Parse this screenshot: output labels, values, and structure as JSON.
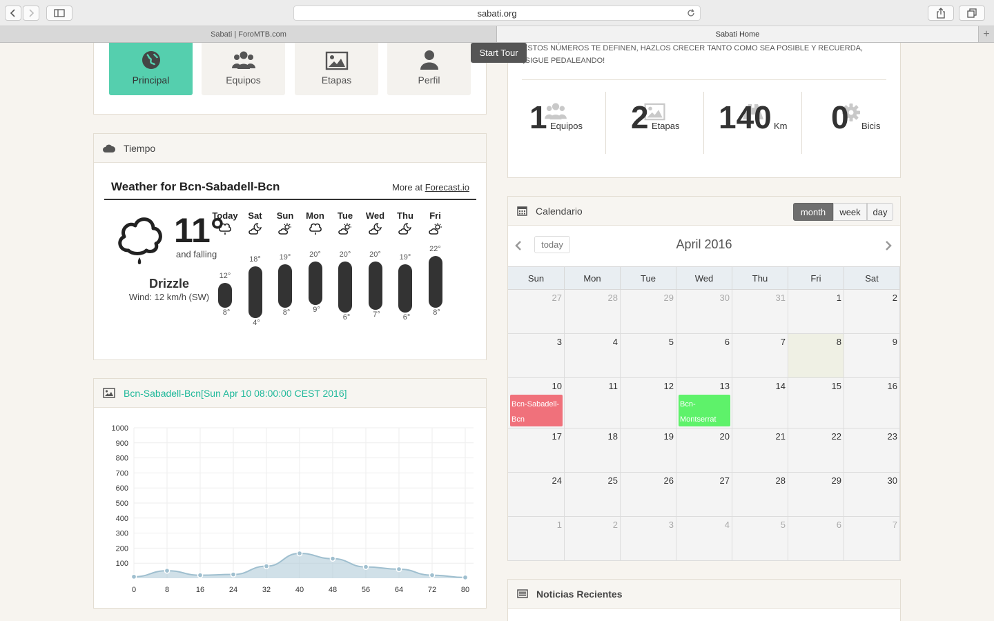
{
  "browser": {
    "url": "sabati.org",
    "tabs": [
      {
        "label": "Sabati | ForoMTB.com",
        "active": false
      },
      {
        "label": "Sabati Home",
        "active": true
      }
    ],
    "new_tab": "+"
  },
  "nav_tiles": [
    {
      "label": "Principal",
      "icon": "globe-icon",
      "active": true
    },
    {
      "label": "Equipos",
      "icon": "group-icon",
      "active": false
    },
    {
      "label": "Etapas",
      "icon": "image-icon",
      "active": false
    },
    {
      "label": "Perfil",
      "icon": "user-icon",
      "active": false
    }
  ],
  "start_tour": "Start Tour",
  "stats_box": {
    "message": "ESTOS NÚMEROS TE DEFINEN, HAZLOS CRECER TANTO COMO SEA POSIBLE Y RECUERDA, ¡SIGUE PEDALEANDO!",
    "stats": [
      {
        "value": "1",
        "label": "Equipos",
        "icon": "group-icon"
      },
      {
        "value": "2",
        "label": "Etapas",
        "icon": "image-icon"
      },
      {
        "value": "140",
        "label": "Km",
        "icon": "road-icon"
      },
      {
        "value": "0",
        "label": "Bicis",
        "icon": "gear-icon"
      }
    ]
  },
  "weather_box": {
    "header": "Tiempo",
    "title": "Weather for Bcn-Sabadell-Bcn",
    "more_prefix": "More at",
    "more_link": "Forecast.io",
    "current_temp": "11°",
    "trend": "and falling",
    "summary": "Drizzle",
    "wind": "Wind: 12 km/h (SW)",
    "forecast": [
      {
        "day": "Today",
        "high": "12°",
        "low": "8°",
        "high_val": 12,
        "low_val": 8,
        "icon": "drizzle-icon"
      },
      {
        "day": "Sat",
        "high": "18°",
        "low": "4°",
        "high_val": 18,
        "low_val": 4,
        "icon": "partly-cloudy-night-icon"
      },
      {
        "day": "Sun",
        "high": "19°",
        "low": "8°",
        "high_val": 19,
        "low_val": 8,
        "icon": "partly-cloudy-day-icon"
      },
      {
        "day": "Mon",
        "high": "20°",
        "low": "9°",
        "high_val": 20,
        "low_val": 9,
        "icon": "drizzle-icon"
      },
      {
        "day": "Tue",
        "high": "20°",
        "low": "6°",
        "high_val": 20,
        "low_val": 6,
        "icon": "partly-cloudy-day-icon"
      },
      {
        "day": "Wed",
        "high": "20°",
        "low": "7°",
        "high_val": 20,
        "low_val": 7,
        "icon": "partly-cloudy-night-icon"
      },
      {
        "day": "Thu",
        "high": "19°",
        "low": "6°",
        "high_val": 19,
        "low_val": 6,
        "icon": "partly-cloudy-night-icon"
      },
      {
        "day": "Fri",
        "high": "22°",
        "low": "8°",
        "high_val": 22,
        "low_val": 8,
        "icon": "partly-cloudy-day-icon"
      }
    ]
  },
  "profile_box": {
    "header": "Bcn-Sabadell-Bcn[Sun Apr 10 08:00:00 CEST 2016]"
  },
  "chart_data": {
    "type": "area",
    "title": "",
    "xlabel": "",
    "ylabel": "",
    "x": [
      0,
      8,
      16,
      24,
      32,
      40,
      48,
      56,
      64,
      72,
      80
    ],
    "series": [
      {
        "values": [
          10,
          50,
          20,
          25,
          80,
          165,
          130,
          75,
          60,
          20,
          5
        ]
      }
    ],
    "xticks": [
      "0",
      "8",
      "16",
      "24",
      "32",
      "40",
      "48",
      "56",
      "64",
      "72",
      "80"
    ],
    "yticks": [
      "100",
      "200",
      "300",
      "400",
      "500",
      "600",
      "700",
      "800",
      "900",
      "1000"
    ],
    "xlim": [
      0,
      80
    ],
    "ylim": [
      0,
      1000
    ],
    "grid": true,
    "color": "#a9c7d6"
  },
  "calendar": {
    "header": "Calendario",
    "views": [
      {
        "label": "month",
        "active": true
      },
      {
        "label": "week",
        "active": false
      },
      {
        "label": "day",
        "active": false
      }
    ],
    "today_label": "today",
    "month_title": "April 2016",
    "weekdays": [
      "Sun",
      "Mon",
      "Tue",
      "Wed",
      "Thu",
      "Fri",
      "Sat"
    ],
    "weeks": [
      [
        {
          "d": "27",
          "o": true
        },
        {
          "d": "28",
          "o": true
        },
        {
          "d": "29",
          "o": true
        },
        {
          "d": "30",
          "o": true
        },
        {
          "d": "31",
          "o": true
        },
        {
          "d": "1"
        },
        {
          "d": "2"
        }
      ],
      [
        {
          "d": "3"
        },
        {
          "d": "4"
        },
        {
          "d": "5"
        },
        {
          "d": "6"
        },
        {
          "d": "7"
        },
        {
          "d": "8",
          "t": true
        },
        {
          "d": "9"
        }
      ],
      [
        {
          "d": "10"
        },
        {
          "d": "11"
        },
        {
          "d": "12"
        },
        {
          "d": "13"
        },
        {
          "d": "14"
        },
        {
          "d": "15"
        },
        {
          "d": "16"
        }
      ],
      [
        {
          "d": "17"
        },
        {
          "d": "18"
        },
        {
          "d": "19"
        },
        {
          "d": "20"
        },
        {
          "d": "21"
        },
        {
          "d": "22"
        },
        {
          "d": "23"
        }
      ],
      [
        {
          "d": "24"
        },
        {
          "d": "25"
        },
        {
          "d": "26"
        },
        {
          "d": "27"
        },
        {
          "d": "28"
        },
        {
          "d": "29"
        },
        {
          "d": "30"
        }
      ],
      [
        {
          "d": "1",
          "o": true
        },
        {
          "d": "2",
          "o": true
        },
        {
          "d": "3",
          "o": true
        },
        {
          "d": "4",
          "o": true
        },
        {
          "d": "5",
          "o": true
        },
        {
          "d": "6",
          "o": true
        },
        {
          "d": "7",
          "o": true
        }
      ]
    ],
    "events": [
      {
        "title": "Bcn-Sabadell-Bcn",
        "week": 2,
        "dow": 0,
        "color": "#f0717b"
      },
      {
        "title": "Bcn-Montserrat",
        "week": 2,
        "dow": 3,
        "color": "#5ef26a"
      }
    ]
  },
  "news_box": {
    "header": "Noticias Recientes"
  },
  "colors": {
    "accent": "#55cfae",
    "teal_text": "#1fb89a",
    "background": "#f7f4ef"
  }
}
